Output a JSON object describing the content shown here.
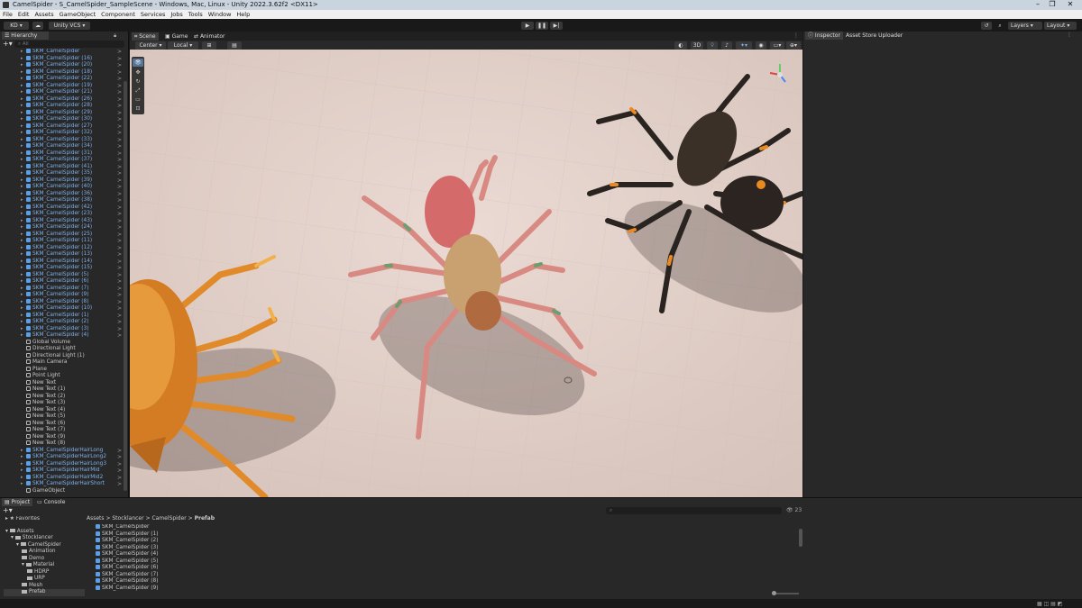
{
  "window": {
    "title": "CamelSpider - S_CamelSpider_SampleScene - Windows, Mac, Linux - Unity 2022.3.62f2 <DX11>"
  },
  "menu": [
    "File",
    "Edit",
    "Assets",
    "GameObject",
    "Component",
    "Services",
    "Jobs",
    "Tools",
    "Window",
    "Help"
  ],
  "toolbar": {
    "account": "KD",
    "vcs": "Unity VCS",
    "layers": "Layers",
    "layout": "Layout"
  },
  "hierarchy": {
    "tab": "Hierarchy",
    "search_placeholder": "All",
    "items": [
      {
        "label": "SKM_CamelSpider",
        "prefab": true
      },
      {
        "label": "SKM_CamelSpider (16)",
        "prefab": true
      },
      {
        "label": "SKM_CamelSpider (20)",
        "prefab": true
      },
      {
        "label": "SKM_CamelSpider (18)",
        "prefab": true
      },
      {
        "label": "SKM_CamelSpider (22)",
        "prefab": true
      },
      {
        "label": "SKM_CamelSpider (19)",
        "prefab": true
      },
      {
        "label": "SKM_CamelSpider (21)",
        "prefab": true
      },
      {
        "label": "SKM_CamelSpider (26)",
        "prefab": true
      },
      {
        "label": "SKM_CamelSpider (28)",
        "prefab": true
      },
      {
        "label": "SKM_CamelSpider (29)",
        "prefab": true
      },
      {
        "label": "SKM_CamelSpider (30)",
        "prefab": true
      },
      {
        "label": "SKM_CamelSpider (27)",
        "prefab": true
      },
      {
        "label": "SKM_CamelSpider (32)",
        "prefab": true
      },
      {
        "label": "SKM_CamelSpider (33)",
        "prefab": true
      },
      {
        "label": "SKM_CamelSpider (34)",
        "prefab": true
      },
      {
        "label": "SKM_CamelSpider (31)",
        "prefab": true
      },
      {
        "label": "SKM_CamelSpider (37)",
        "prefab": true
      },
      {
        "label": "SKM_CamelSpider (41)",
        "prefab": true
      },
      {
        "label": "SKM_CamelSpider (35)",
        "prefab": true
      },
      {
        "label": "SKM_CamelSpider (39)",
        "prefab": true
      },
      {
        "label": "SKM_CamelSpider (40)",
        "prefab": true
      },
      {
        "label": "SKM_CamelSpider (36)",
        "prefab": true
      },
      {
        "label": "SKM_CamelSpider (38)",
        "prefab": true
      },
      {
        "label": "SKM_CamelSpider (42)",
        "prefab": true
      },
      {
        "label": "SKM_CamelSpider (23)",
        "prefab": true
      },
      {
        "label": "SKM_CamelSpider (43)",
        "prefab": true
      },
      {
        "label": "SKM_CamelSpider (24)",
        "prefab": true
      },
      {
        "label": "SKM_CamelSpider (25)",
        "prefab": true
      },
      {
        "label": "SKM_CamelSpider (11)",
        "prefab": true
      },
      {
        "label": "SKM_CamelSpider (12)",
        "prefab": true
      },
      {
        "label": "SKM_CamelSpider (13)",
        "prefab": true
      },
      {
        "label": "SKM_CamelSpider (14)",
        "prefab": true
      },
      {
        "label": "SKM_CamelSpider (15)",
        "prefab": true
      },
      {
        "label": "SKM_CamelSpider (5)",
        "prefab": true
      },
      {
        "label": "SKM_CamelSpider (6)",
        "prefab": true
      },
      {
        "label": "SKM_CamelSpider (7)",
        "prefab": true
      },
      {
        "label": "SKM_CamelSpider (9)",
        "prefab": true
      },
      {
        "label": "SKM_CamelSpider (8)",
        "prefab": true
      },
      {
        "label": "SKM_CamelSpider (10)",
        "prefab": true
      },
      {
        "label": "SKM_CamelSpider (1)",
        "prefab": true
      },
      {
        "label": "SKM_CamelSpider (2)",
        "prefab": true
      },
      {
        "label": "SKM_CamelSpider (3)",
        "prefab": true
      },
      {
        "label": "SKM_CamelSpider (4)",
        "prefab": true
      },
      {
        "label": "Global Volume",
        "prefab": false
      },
      {
        "label": "Directional Light",
        "prefab": false
      },
      {
        "label": "Directional Light (1)",
        "prefab": false
      },
      {
        "label": "Main Camera",
        "prefab": false
      },
      {
        "label": "Plane",
        "prefab": false
      },
      {
        "label": "Point Light",
        "prefab": false
      },
      {
        "label": "New Text",
        "prefab": false
      },
      {
        "label": "New Text (1)",
        "prefab": false
      },
      {
        "label": "New Text (2)",
        "prefab": false
      },
      {
        "label": "New Text (3)",
        "prefab": false
      },
      {
        "label": "New Text (4)",
        "prefab": false
      },
      {
        "label": "New Text (5)",
        "prefab": false
      },
      {
        "label": "New Text (6)",
        "prefab": false
      },
      {
        "label": "New Text (7)",
        "prefab": false
      },
      {
        "label": "New Text (9)",
        "prefab": false
      },
      {
        "label": "New Text (8)",
        "prefab": false
      },
      {
        "label": "SKM_CamelSpiderHairLong",
        "prefab": true
      },
      {
        "label": "SKM_CamelSpiderHairLong2",
        "prefab": true
      },
      {
        "label": "SKM_CamelSpiderHairLong3",
        "prefab": true
      },
      {
        "label": "SKM_CamelSpiderHairMid",
        "prefab": true
      },
      {
        "label": "SKM_CamelSpiderHairMid2",
        "prefab": true
      },
      {
        "label": "SKM_CamelSpiderHairShort",
        "prefab": true
      },
      {
        "label": "GameObject",
        "prefab": false
      }
    ]
  },
  "scene": {
    "tabs": [
      "Scene",
      "Game",
      "Animator"
    ],
    "pivot": "Center",
    "space": "Local",
    "mode_2d3d": "3D"
  },
  "inspector": {
    "tabs": [
      "Inspector",
      "Asset Store Uploader"
    ]
  },
  "project": {
    "tabs": [
      "Project",
      "Console"
    ],
    "favorites": "Favorites",
    "tree": [
      {
        "label": "Assets",
        "depth": 0
      },
      {
        "label": "Stocklancer",
        "depth": 1
      },
      {
        "label": "CamelSpider",
        "depth": 2
      },
      {
        "label": "Animation",
        "depth": 3
      },
      {
        "label": "Demo",
        "depth": 3
      },
      {
        "label": "Material",
        "depth": 3
      },
      {
        "label": "HDRP",
        "depth": 4
      },
      {
        "label": "URP",
        "depth": 4
      },
      {
        "label": "Mesh",
        "depth": 3
      },
      {
        "label": "Prefab",
        "depth": 3
      }
    ],
    "breadcrumb": [
      "Assets",
      "Stocklancer",
      "CamelSpider",
      "Prefab"
    ],
    "hidden_count": "23",
    "files": [
      "SKM_CamelSpider",
      "SKM_CamelSpider (1)",
      "SKM_CamelSpider (2)",
      "SKM_CamelSpider (3)",
      "SKM_CamelSpider (4)",
      "SKM_CamelSpider (5)",
      "SKM_CamelSpider (6)",
      "SKM_CamelSpider (7)",
      "SKM_CamelSpider (8)",
      "SKM_CamelSpider (9)"
    ]
  },
  "icons": {
    "play": "play-icon",
    "pause": "pause-icon",
    "step": "step-icon",
    "search": "search-icon",
    "cloud": "cloud-icon",
    "history": "history-icon"
  },
  "colors": {
    "prefab_blue": "#7fb0e8",
    "editor_bg": "#282828",
    "floor": "#e4d3cc"
  }
}
